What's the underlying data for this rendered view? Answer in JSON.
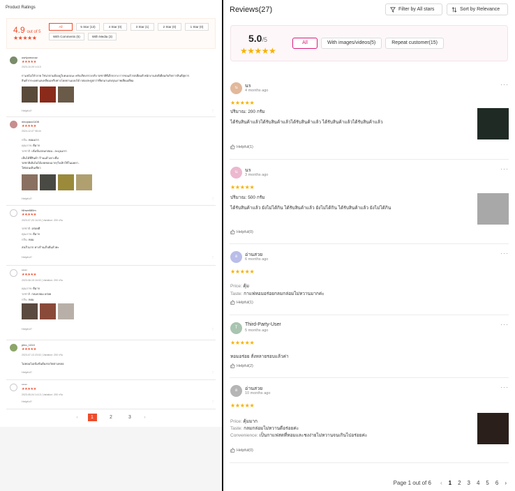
{
  "left": {
    "title": "Product Ratings",
    "score": "4.9",
    "out_of": "out of 5",
    "stars": "★★★★★",
    "filters": [
      "All",
      "5 Star (13)",
      "4 Star (0)",
      "3 Star (1)",
      "2 Star (0)",
      "1 Star (0)",
      "With Comments (5)",
      "With Media (3)"
    ],
    "reviews": [
      {
        "name": "usrfyomcrow",
        "stars": "★★★★★",
        "date": "2023-10-09 14:13",
        "text1": "กาแฟไม่ใจำลาย ใช่น่าตามต้องดูใบคนบบนะ ครับเรียบรรวงจริง รสชาติที่เล็กกลาง การชงแล้วรสเยี่ยมดี พนักงานส่งดีเยี่ยมกับกิจการสินดีสุดาร",
        "text2": "สินค้ากระแทกแลเหลี่ยมเหรีบทางโดยยานแบบได้ กล่องสะดูปกว่าที่ยกมาแต่งกุณภาพเยี่ยมเยี่ยม",
        "helpful": "Helpful?"
      },
      {
        "name": "ninopaco1108",
        "stars": "★★★★★",
        "date": "2024-12-07 08:44",
        "l1k": "กลิ่น:",
        "l1v": "หอมมาก",
        "l2k": "คุณภาพ:",
        "l2v": "ดีมาก",
        "l3k": "รสชาติ:",
        "l3v": "เข้มข้นกลมกล่อม...ละมุนมาก",
        "t1": "เห็นได้ที่สินค้า ร้านแล้วเจาะดื่ม",
        "t2": "รสชาติเดิมไม่ได้เลยชอบมากๆวิ่งเลิกใช้ในแพลา..",
        "t3": "ใส่ตอนเดินเขียว",
        "helpful": "Helpful?"
      },
      {
        "name": "f4hwe880m",
        "stars": "★★★★★",
        "date": "2023-07-20 16:33 | Variation: 200 กรัม",
        "l1k": "รสชาติ:",
        "l1v": "อร่อยดี",
        "l2k": "คุณภาพ:",
        "l2v": "ดีมาก",
        "l3k": "กลิ่น:",
        "l3v": "หอม",
        "t1": "ส่งเร็วมาก ทางร้านเก็บดีแล้วค่ะ",
        "helpful": "Helpful?"
      },
      {
        "name": "*****",
        "stars": "★★★★★",
        "date": "2023-06-15 16:02 | Variation: 200 กรัม",
        "l1k": "คุณภาพ:",
        "l1v": "ดีมาก",
        "l2k": "รสชาติ:",
        "l2v": "กลมกล่อม อร่อย",
        "l3k": "กลิ่น:",
        "l3v": "หอม",
        "helpful": "Helpful?"
      },
      {
        "name": "pino_1414",
        "stars": "★★★★★",
        "date": "2023-07-13 23:02 | Variation: 200 กรัม",
        "t1": "ไม่หอมไม่เข้มข้นต้องรอวัดตามหลอ",
        "helpful": "Helpful?"
      },
      {
        "name": "*****",
        "stars": "★★★★★",
        "date": "2023-05-04 14:13 | Variation: 200 กรัม",
        "helpful": "Helpful?"
      }
    ],
    "pages": [
      "‹",
      "1",
      "2",
      "3",
      "›"
    ]
  },
  "right": {
    "title": "Reviews(27)",
    "filter_btn": "Filter by All stars",
    "sort_btn": "Sort by Relevance",
    "score": "5.0",
    "den": "/5",
    "stars": "★★★★★",
    "filters": [
      "All",
      "With images/videos(5)",
      "Repeat customer(15)"
    ],
    "reviews": [
      {
        "avatar": "น",
        "name": "นร",
        "when": "4 months ago",
        "stars": "★★★★★",
        "l1": "ปริมาณ: 200 กรัม",
        "l2": "ได้รับสินค้าแล้วได้รับสินค้าแล้วได้รับสินค้าแล้ว ได้รับสินค้าแล้วได้รับสินค้าแล้ว",
        "helpful": "Helpful(1)",
        "color": "#e2b89a"
      },
      {
        "avatar": "น",
        "name": "นร",
        "when": "3 months ago",
        "stars": "★★★★★",
        "l1": "ปริมาณ: 500 กรัม",
        "l2": "ได้รับสินค้าแล้ว ยังไม่ได้กิน ได้รับสินค้าแล้ว ยังไม่ได้กิน ได้รับสินค้าแล้ว ยังไม่ได้กิน",
        "helpful": "Helpful(0)",
        "color": "#ecb8cf"
      },
      {
        "avatar": "อ",
        "name": "อ่านสวย",
        "when": "6 months ago",
        "stars": "★★★★★",
        "k1": "Price:",
        "v1": " คุ้ม",
        "k2": "Taste:",
        "v2": " กาแฟหอมอร่อยกลมกล่อมไม่หวานมากค่ะ",
        "helpful": "Helpful(1)",
        "color": "#b9bde8"
      },
      {
        "avatar": "T",
        "name": "Third-Party-User",
        "when": "5 months ago",
        "stars": "★★★★★",
        "l2": "หอมอร่อย สั่งหลายรอบแล้วค่า",
        "helpful": "Helpful(2)",
        "color": "#a9c4b0"
      },
      {
        "avatar": "อ",
        "name": "อ่านสวย",
        "when": "10 months ago",
        "stars": "★★★★★",
        "k1": "Price:",
        "v1": " คุ้มมาก",
        "k2": "Taste:",
        "v2": " กลมกล่อมไม่หวานดีอร่อยค่ะ",
        "k3": "Convenience:",
        "v3": " เป็นกาแฟสดที่หอมและชงง่ายไม่หวานจนเกินไปอร่อยค่ะ",
        "helpful": "Helpful(0)",
        "color": "#b5b5b5"
      }
    ],
    "pager": {
      "info": "Page 1 out of 6",
      "prev": "‹",
      "pages": [
        "1",
        "2",
        "3",
        "4",
        "5",
        "6"
      ],
      "next": "›"
    }
  },
  "colors": {
    "left_accent": "#ee4d2d",
    "right_accent": "#d81b7a",
    "star_gold": "#f6b100"
  }
}
